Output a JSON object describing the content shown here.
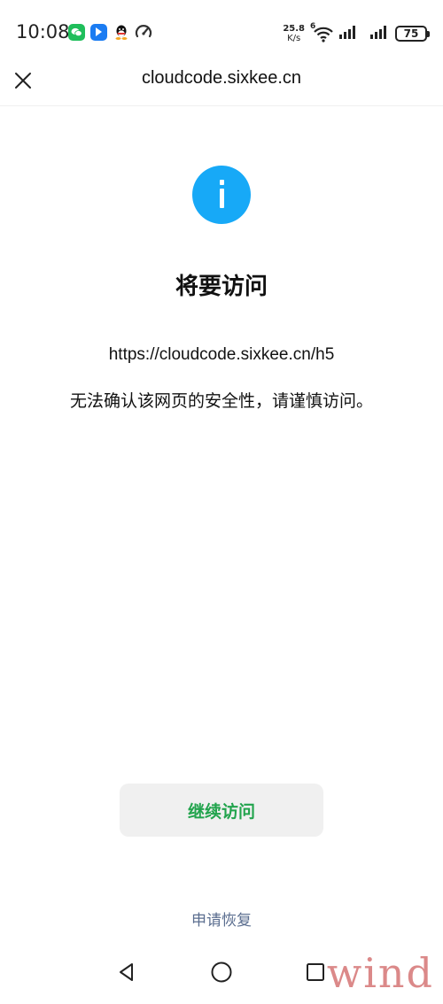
{
  "status_bar": {
    "time": "10:08",
    "net_speed_value": "25.8",
    "net_speed_unit": "K/s",
    "wifi_label": "6",
    "battery": "75",
    "apps": [
      "wechat-icon",
      "blue-app-icon",
      "qq-icon",
      "speedometer-icon"
    ]
  },
  "title_bar": {
    "title": "cloudcode.sixkee.cn",
    "close_icon": "close-icon"
  },
  "main": {
    "icon": "info-icon",
    "heading": "将要访问",
    "url": "https://cloudcode.sixkee.cn/h5",
    "warning": "无法确认该网页的安全性，请谨慎访问。",
    "continue_label": "继续访问",
    "appeal_label": "申请恢复"
  },
  "nav_bar": {
    "icons": [
      "back-triangle-icon",
      "home-circle-icon",
      "recent-square-icon"
    ]
  },
  "watermark": "wind",
  "colors": {
    "accent_green": "#22a44d",
    "info_blue": "#17a9f7",
    "link_gray_blue": "#5a6d8f"
  }
}
